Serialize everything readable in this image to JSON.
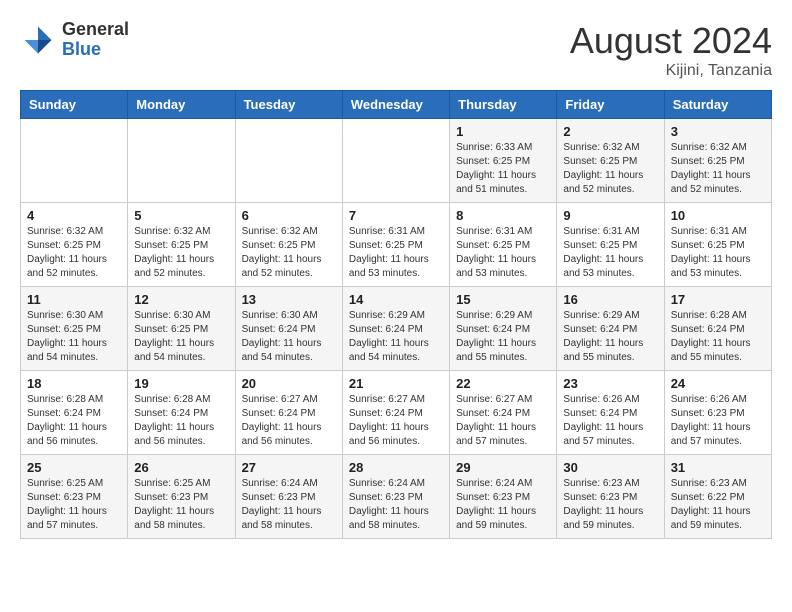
{
  "logo": {
    "general": "General",
    "blue": "Blue"
  },
  "title": {
    "month_year": "August 2024",
    "location": "Kijini, Tanzania"
  },
  "weekdays": [
    "Sunday",
    "Monday",
    "Tuesday",
    "Wednesday",
    "Thursday",
    "Friday",
    "Saturday"
  ],
  "weeks": [
    [
      {
        "day": "",
        "sunrise": "",
        "sunset": "",
        "daylight": ""
      },
      {
        "day": "",
        "sunrise": "",
        "sunset": "",
        "daylight": ""
      },
      {
        "day": "",
        "sunrise": "",
        "sunset": "",
        "daylight": ""
      },
      {
        "day": "",
        "sunrise": "",
        "sunset": "",
        "daylight": ""
      },
      {
        "day": "1",
        "sunrise": "Sunrise: 6:33 AM",
        "sunset": "Sunset: 6:25 PM",
        "daylight": "Daylight: 11 hours and 51 minutes."
      },
      {
        "day": "2",
        "sunrise": "Sunrise: 6:32 AM",
        "sunset": "Sunset: 6:25 PM",
        "daylight": "Daylight: 11 hours and 52 minutes."
      },
      {
        "day": "3",
        "sunrise": "Sunrise: 6:32 AM",
        "sunset": "Sunset: 6:25 PM",
        "daylight": "Daylight: 11 hours and 52 minutes."
      }
    ],
    [
      {
        "day": "4",
        "sunrise": "Sunrise: 6:32 AM",
        "sunset": "Sunset: 6:25 PM",
        "daylight": "Daylight: 11 hours and 52 minutes."
      },
      {
        "day": "5",
        "sunrise": "Sunrise: 6:32 AM",
        "sunset": "Sunset: 6:25 PM",
        "daylight": "Daylight: 11 hours and 52 minutes."
      },
      {
        "day": "6",
        "sunrise": "Sunrise: 6:32 AM",
        "sunset": "Sunset: 6:25 PM",
        "daylight": "Daylight: 11 hours and 52 minutes."
      },
      {
        "day": "7",
        "sunrise": "Sunrise: 6:31 AM",
        "sunset": "Sunset: 6:25 PM",
        "daylight": "Daylight: 11 hours and 53 minutes."
      },
      {
        "day": "8",
        "sunrise": "Sunrise: 6:31 AM",
        "sunset": "Sunset: 6:25 PM",
        "daylight": "Daylight: 11 hours and 53 minutes."
      },
      {
        "day": "9",
        "sunrise": "Sunrise: 6:31 AM",
        "sunset": "Sunset: 6:25 PM",
        "daylight": "Daylight: 11 hours and 53 minutes."
      },
      {
        "day": "10",
        "sunrise": "Sunrise: 6:31 AM",
        "sunset": "Sunset: 6:25 PM",
        "daylight": "Daylight: 11 hours and 53 minutes."
      }
    ],
    [
      {
        "day": "11",
        "sunrise": "Sunrise: 6:30 AM",
        "sunset": "Sunset: 6:25 PM",
        "daylight": "Daylight: 11 hours and 54 minutes."
      },
      {
        "day": "12",
        "sunrise": "Sunrise: 6:30 AM",
        "sunset": "Sunset: 6:25 PM",
        "daylight": "Daylight: 11 hours and 54 minutes."
      },
      {
        "day": "13",
        "sunrise": "Sunrise: 6:30 AM",
        "sunset": "Sunset: 6:24 PM",
        "daylight": "Daylight: 11 hours and 54 minutes."
      },
      {
        "day": "14",
        "sunrise": "Sunrise: 6:29 AM",
        "sunset": "Sunset: 6:24 PM",
        "daylight": "Daylight: 11 hours and 54 minutes."
      },
      {
        "day": "15",
        "sunrise": "Sunrise: 6:29 AM",
        "sunset": "Sunset: 6:24 PM",
        "daylight": "Daylight: 11 hours and 55 minutes."
      },
      {
        "day": "16",
        "sunrise": "Sunrise: 6:29 AM",
        "sunset": "Sunset: 6:24 PM",
        "daylight": "Daylight: 11 hours and 55 minutes."
      },
      {
        "day": "17",
        "sunrise": "Sunrise: 6:28 AM",
        "sunset": "Sunset: 6:24 PM",
        "daylight": "Daylight: 11 hours and 55 minutes."
      }
    ],
    [
      {
        "day": "18",
        "sunrise": "Sunrise: 6:28 AM",
        "sunset": "Sunset: 6:24 PM",
        "daylight": "Daylight: 11 hours and 56 minutes."
      },
      {
        "day": "19",
        "sunrise": "Sunrise: 6:28 AM",
        "sunset": "Sunset: 6:24 PM",
        "daylight": "Daylight: 11 hours and 56 minutes."
      },
      {
        "day": "20",
        "sunrise": "Sunrise: 6:27 AM",
        "sunset": "Sunset: 6:24 PM",
        "daylight": "Daylight: 11 hours and 56 minutes."
      },
      {
        "day": "21",
        "sunrise": "Sunrise: 6:27 AM",
        "sunset": "Sunset: 6:24 PM",
        "daylight": "Daylight: 11 hours and 56 minutes."
      },
      {
        "day": "22",
        "sunrise": "Sunrise: 6:27 AM",
        "sunset": "Sunset: 6:24 PM",
        "daylight": "Daylight: 11 hours and 57 minutes."
      },
      {
        "day": "23",
        "sunrise": "Sunrise: 6:26 AM",
        "sunset": "Sunset: 6:24 PM",
        "daylight": "Daylight: 11 hours and 57 minutes."
      },
      {
        "day": "24",
        "sunrise": "Sunrise: 6:26 AM",
        "sunset": "Sunset: 6:23 PM",
        "daylight": "Daylight: 11 hours and 57 minutes."
      }
    ],
    [
      {
        "day": "25",
        "sunrise": "Sunrise: 6:25 AM",
        "sunset": "Sunset: 6:23 PM",
        "daylight": "Daylight: 11 hours and 57 minutes."
      },
      {
        "day": "26",
        "sunrise": "Sunrise: 6:25 AM",
        "sunset": "Sunset: 6:23 PM",
        "daylight": "Daylight: 11 hours and 58 minutes."
      },
      {
        "day": "27",
        "sunrise": "Sunrise: 6:24 AM",
        "sunset": "Sunset: 6:23 PM",
        "daylight": "Daylight: 11 hours and 58 minutes."
      },
      {
        "day": "28",
        "sunrise": "Sunrise: 6:24 AM",
        "sunset": "Sunset: 6:23 PM",
        "daylight": "Daylight: 11 hours and 58 minutes."
      },
      {
        "day": "29",
        "sunrise": "Sunrise: 6:24 AM",
        "sunset": "Sunset: 6:23 PM",
        "daylight": "Daylight: 11 hours and 59 minutes."
      },
      {
        "day": "30",
        "sunrise": "Sunrise: 6:23 AM",
        "sunset": "Sunset: 6:23 PM",
        "daylight": "Daylight: 11 hours and 59 minutes."
      },
      {
        "day": "31",
        "sunrise": "Sunrise: 6:23 AM",
        "sunset": "Sunset: 6:22 PM",
        "daylight": "Daylight: 11 hours and 59 minutes."
      }
    ]
  ]
}
